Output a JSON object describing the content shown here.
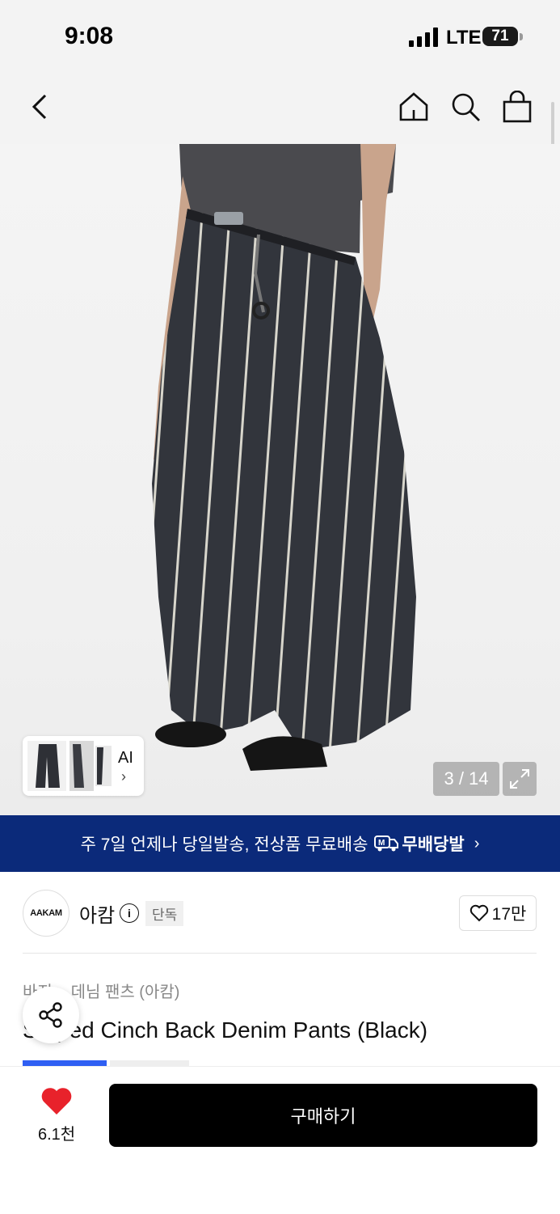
{
  "status_bar": {
    "time": "9:08",
    "network": "LTE",
    "battery": "71"
  },
  "header": {
    "icons": [
      "back-icon",
      "home-icon",
      "search-icon",
      "cart-icon"
    ]
  },
  "gallery": {
    "ai_label": "AI",
    "ai_chevron": "›",
    "counter": "3 / 14",
    "expand_icon": "expand-icon"
  },
  "banner": {
    "text": "주 7일 언제나 당일발송, 전상품 무료배송",
    "brand": "무배당발",
    "arrow": "›"
  },
  "brand": {
    "logo_text": "AAKAM",
    "name": "아캄",
    "info_icon": "i",
    "badge": "단독",
    "like_count": "17만"
  },
  "product": {
    "breadcrumb": "바지  >  데님 팬츠 (아캄)",
    "title": "Striped Cinch Back Denim Pants (Black)"
  },
  "bottom_bar": {
    "like_count": "6.1천",
    "buy_label": "구매하기"
  },
  "colors": {
    "banner_bg": "#0b2a7a",
    "heart": "#e8222b",
    "buy_bg": "#000000",
    "tag_blue": "#2f5ff3"
  }
}
